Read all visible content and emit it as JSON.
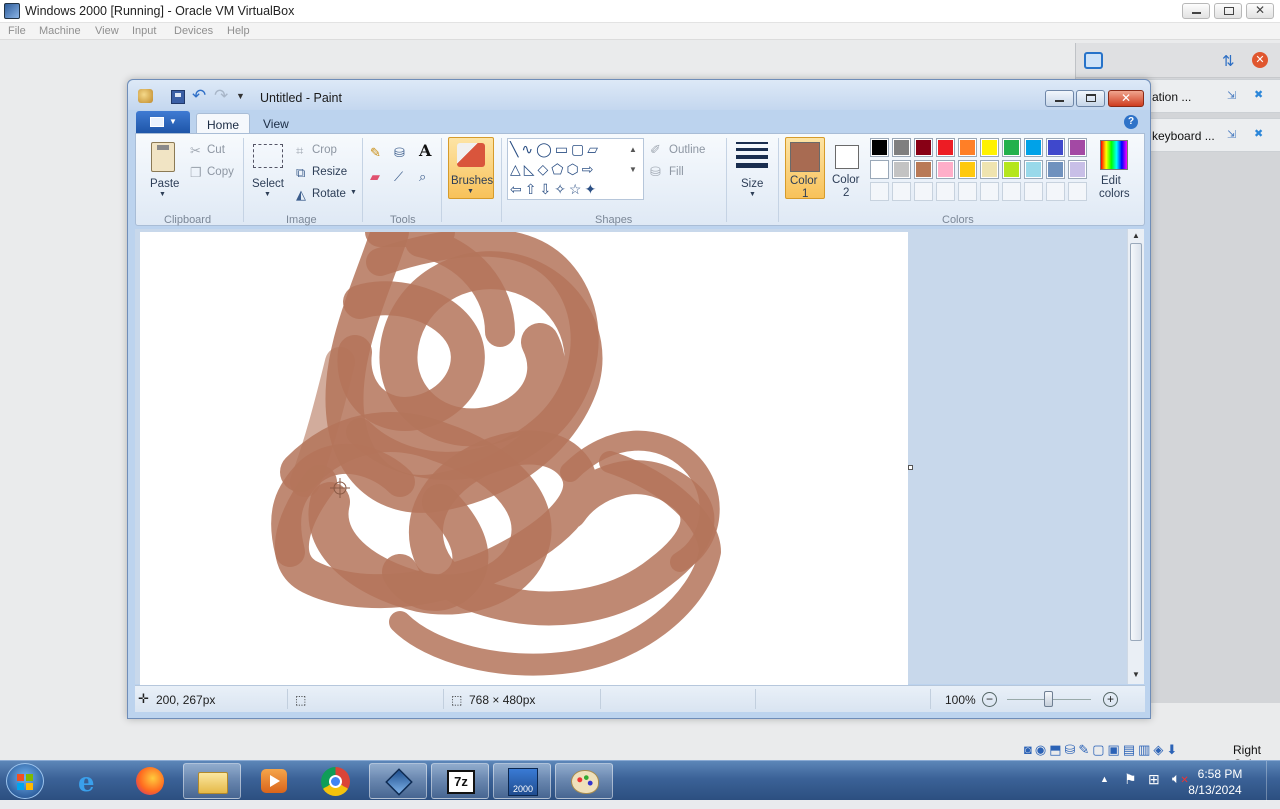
{
  "host": {
    "title": "Windows 2000 [Running] - Oracle VM VirtualBox",
    "menu": [
      "File",
      "Machine",
      "View",
      "Input",
      "Devices",
      "Help"
    ],
    "status_right": "Right Ctrl"
  },
  "side_panel": {
    "items": [
      "ation ...",
      "keyboard ..."
    ]
  },
  "paint": {
    "title": "Untitled - Paint",
    "tabs": [
      "Home",
      "View"
    ],
    "clipboard": {
      "paste": "Paste",
      "cut": "Cut",
      "copy": "Copy",
      "group": "Clipboard"
    },
    "image": {
      "select": "Select",
      "crop": "Crop",
      "resize": "Resize",
      "rotate": "Rotate",
      "group": "Image"
    },
    "tools_group": "Tools",
    "brushes": "Brushes",
    "shapes": {
      "outline": "Outline",
      "fill": "Fill",
      "group": "Shapes"
    },
    "size": "Size",
    "color1": {
      "label": "Color",
      "num": "1",
      "value": "#a86b52"
    },
    "color2": {
      "label": "Color",
      "num": "2",
      "value": "#ffffff"
    },
    "edit_colors": [
      "Edit",
      "colors"
    ],
    "colors_group": "Colors",
    "palette_row1": [
      "#000000",
      "#7f7f7f",
      "#880015",
      "#ed1c24",
      "#ff7f27",
      "#fff200",
      "#22b14c",
      "#00a2e8",
      "#3f48cc",
      "#a349a4"
    ],
    "palette_row2": [
      "#ffffff",
      "#c3c3c3",
      "#b97a57",
      "#ffaec9",
      "#ffc90e",
      "#efe4b0",
      "#b5e61d",
      "#99d9ea",
      "#7092be",
      "#c8bfe7"
    ],
    "status": {
      "cursor": "200, 267px",
      "canvas_size": "768 × 480px",
      "zoom": "100%"
    }
  },
  "taskbar": {
    "time": "6:58 PM",
    "date": "8/13/2024",
    "pinned": [
      "start-orb",
      "internet-explorer",
      "firefox",
      "file-explorer",
      "media-player",
      "chrome",
      "virtualbox",
      "7zip",
      "windows-2000-vm",
      "paint"
    ]
  }
}
